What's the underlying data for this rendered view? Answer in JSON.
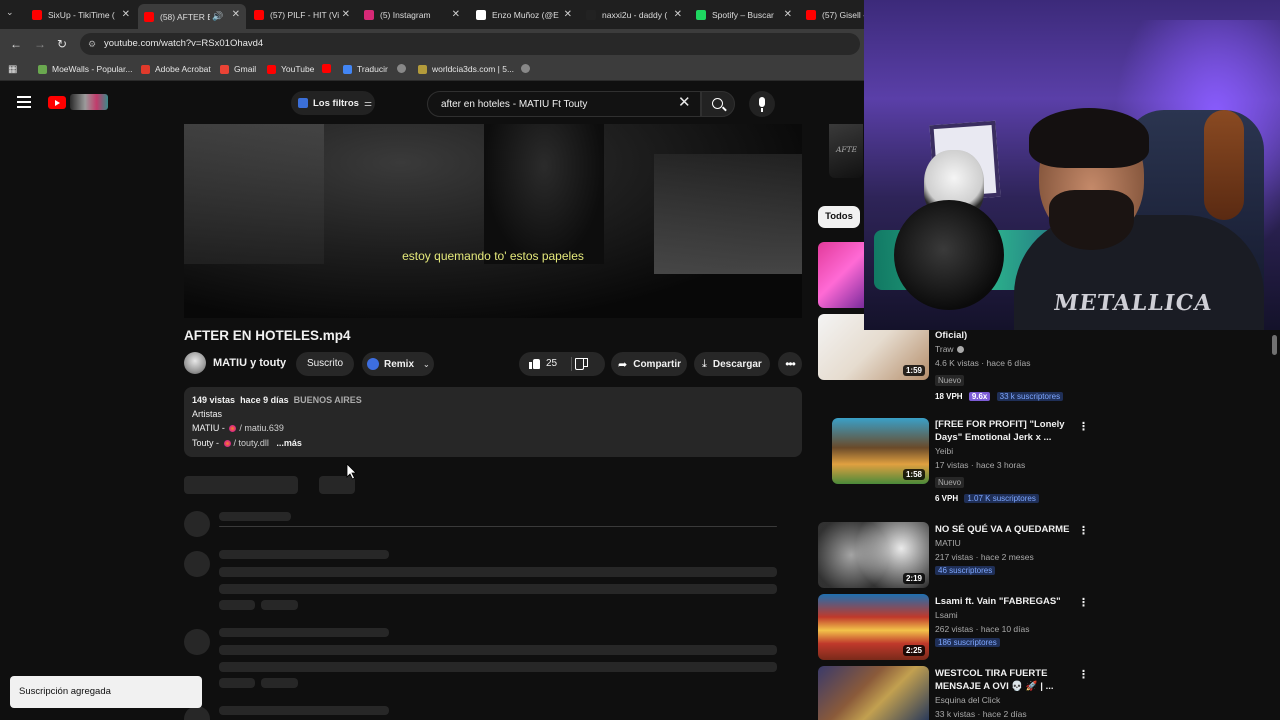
{
  "browser": {
    "tabs": [
      {
        "label": "SixUp - TikiTime (",
        "favicon_color": "#ff0000",
        "active": false
      },
      {
        "label": "(58) AFTER EN",
        "favicon_color": "#ff0000",
        "active": true
      },
      {
        "label": "(57) PILF - HIT (Vi",
        "favicon_color": "#ff0000",
        "active": false
      },
      {
        "label": "(5) Instagram",
        "favicon_color": "#d62976",
        "active": false
      },
      {
        "label": "Enzo Muñoz (@E",
        "favicon_color": "#ffffff",
        "active": false
      },
      {
        "label": "naxxi2u - daddy (",
        "favicon_color": "#222222",
        "active": false
      },
      {
        "label": "Spotify – Buscar",
        "favicon_color": "#1ed760",
        "active": false
      },
      {
        "label": "(57) Gisell -",
        "favicon_color": "#ff0000",
        "active": false
      }
    ],
    "tab_close_glyph": "✕",
    "url": "youtube.com/watch?v=RSx01Ohavd4",
    "bookmarks": [
      {
        "label": "MoeWalls - Popular...",
        "color": "#6aa84f"
      },
      {
        "label": "Adobe Acrobat",
        "color": "#e03a2b"
      },
      {
        "label": "Gmail",
        "color": "#ea4335"
      },
      {
        "label": "YouTube",
        "color": "#ff0000"
      },
      {
        "label": "",
        "color": "#ff0000"
      },
      {
        "label": "Traducir",
        "color": "#4285f4"
      },
      {
        "label": "",
        "color": "#888888"
      },
      {
        "label": "worldcia3ds.com | 5...",
        "color": "#b39b3b"
      },
      {
        "label": "",
        "color": "#888888"
      }
    ]
  },
  "masthead": {
    "filters_label": "Los filtros",
    "search_value": "after en hoteles - MATIU Ft Touty"
  },
  "video": {
    "subtitle": "estoy quemando to' estos papeles",
    "title": "AFTER EN HOTELES.mp4",
    "channel": "MATIU y touty",
    "subscribed_label": "Suscrito",
    "remix_label": "Remix",
    "likes": "25",
    "share_label": "Compartir",
    "download_label": "Descargar",
    "description": {
      "views": "149 vistas",
      "age": "hace 9 días",
      "location": "BUENOS AIRES",
      "line2": "Artistas",
      "artist1_name": "MATIU - ",
      "artist1_handle": "/ matiu.639",
      "artist2_name": "Touty - ",
      "artist2_handle": "/ touty.dll",
      "more": "...más"
    }
  },
  "toast": "Suscripción agregada",
  "sidebar": {
    "top_thumb_text": "AFTE",
    "chip": "Todos",
    "recommendations": [
      {
        "title": "Oficial)",
        "channel": "Traw",
        "verified": true,
        "meta": "4.6 K vistas · hace 6 días",
        "badge": "Nuevo",
        "vph": "18 VPH",
        "multiplier": "9.6x",
        "subs": "33 k suscriptores",
        "duration": "1:59",
        "thumb_colors": [
          "#f4f4f4",
          "#d9c3b0"
        ]
      },
      {
        "title": "[FREE FOR PROFIT] \"Lonely Days\" Emotional Jerk x ...",
        "channel": "Yeibi",
        "verified": false,
        "meta": "17 vistas · hace 3 horas",
        "badge": "Nuevo",
        "vph": "6 VPH",
        "multiplier": "",
        "subs": "1.07 K suscriptores",
        "duration": "1:58",
        "thumb_colors": [
          "#7a5a3a",
          "#3aa0c8"
        ]
      },
      {
        "title": "NO SÉ QUÉ VA A QUEDARME",
        "channel": "MATIU",
        "verified": false,
        "meta": "217 vistas · hace 2 meses",
        "badge": "",
        "vph": "",
        "multiplier": "",
        "subs": "46 suscriptores",
        "duration": "2:19",
        "thumb_colors": [
          "#1a1a1a",
          "#dcdcdc"
        ]
      },
      {
        "title": "Lsami ft. Vain \"FABREGAS\"",
        "channel": "Lsami",
        "verified": false,
        "meta": "262 vistas · hace 10 días",
        "badge": "",
        "vph": "",
        "multiplier": "",
        "subs": "186 suscriptores",
        "duration": "2:25",
        "thumb_colors": [
          "#c0392b",
          "#f3c34a"
        ]
      },
      {
        "title": "WESTCOL TIRA FUERTE MENSAJE A OVI 💀 🚀 | ...",
        "channel": "Esquina del Click",
        "verified": false,
        "meta": "33 k vistas · hace 2 días",
        "badge": "",
        "vph": "",
        "multiplier": "",
        "subs": "",
        "duration": "",
        "thumb_colors": [
          "#3a3a6a",
          "#c2a050"
        ]
      }
    ]
  },
  "webcam": {
    "shirt_text": "METALLICA"
  }
}
